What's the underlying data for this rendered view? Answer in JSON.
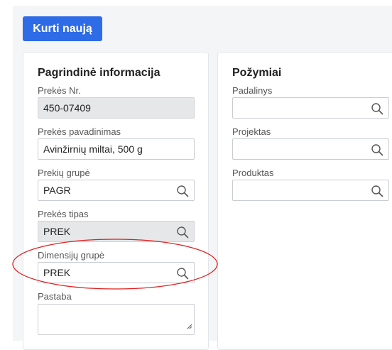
{
  "toolbar": {
    "create_label": "Kurti naują"
  },
  "main_info": {
    "title": "Pagrindinė informacija",
    "item_no": {
      "label": "Prekės Nr.",
      "value": "450-07409"
    },
    "item_name": {
      "label": "Prekės pavadinimas",
      "value": "Avinžirnių miltai, 500 g"
    },
    "item_group": {
      "label": "Prekių grupė",
      "value": "PAGR"
    },
    "item_type": {
      "label": "Prekės tipas",
      "value": "PREK"
    },
    "dimension_group": {
      "label": "Dimensijų grupė",
      "value": "PREK"
    },
    "note": {
      "label": "Pastaba",
      "value": ""
    }
  },
  "attributes": {
    "title": "Požymiai",
    "department": {
      "label": "Padalinys",
      "value": ""
    },
    "project": {
      "label": "Projektas",
      "value": ""
    },
    "product": {
      "label": "Produktas",
      "value": ""
    }
  },
  "colors": {
    "primary": "#2e6be6",
    "annotation": "#e02020",
    "readonly_bg": "#e6e7e9"
  },
  "icons": {
    "lookup": "search-icon",
    "resize": "resize-handle-icon"
  }
}
